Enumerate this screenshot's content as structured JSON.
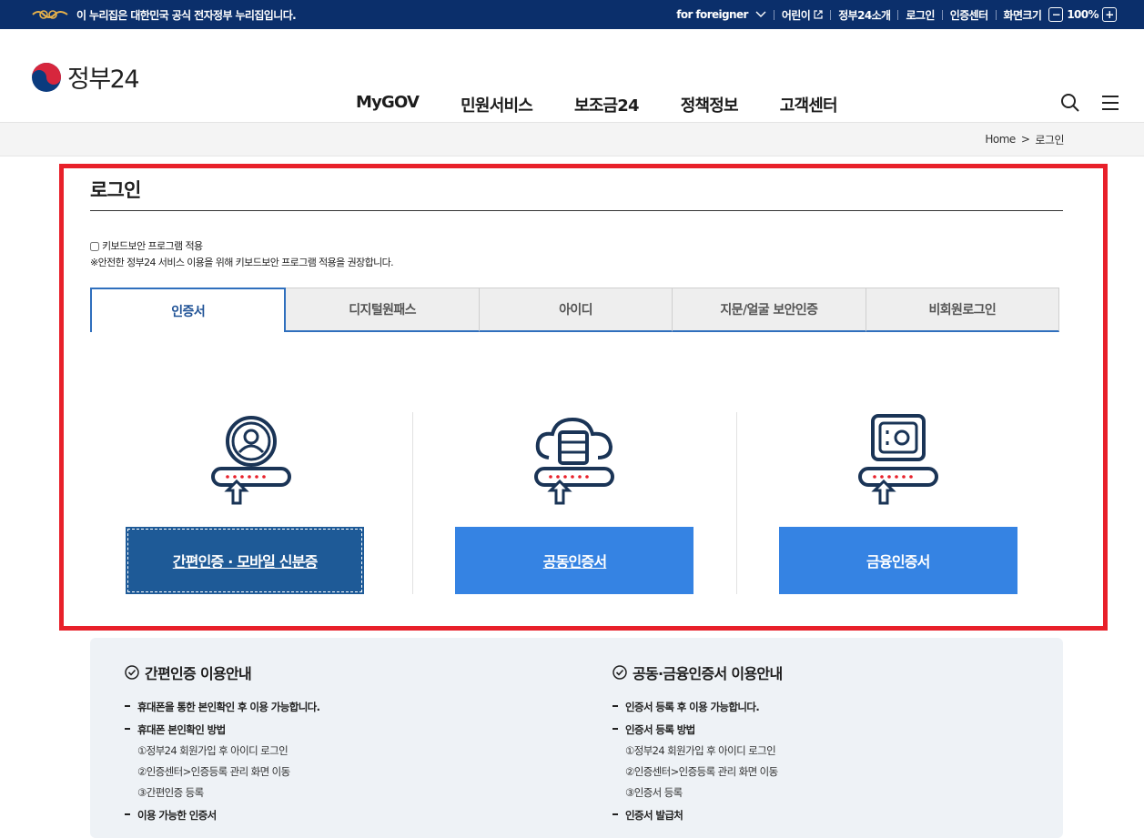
{
  "gov_banner": {
    "notice": "이 누리집은 대한민국 공식 전자정부 누리집입니다.",
    "links": [
      "for foreigner",
      "어린이",
      "정부24소개",
      "로그인",
      "인증센터"
    ],
    "screen_size_label": "화면크기",
    "zoom_level": "100%",
    "zoom_out": "−",
    "zoom_in": "+"
  },
  "header": {
    "logo_text": "정부24",
    "nav": [
      "MyGOV",
      "민원서비스",
      "보조금24",
      "정책정보",
      "고객센터"
    ]
  },
  "breadcrumb": {
    "home": "Home",
    "separator": ">",
    "current": "로그인"
  },
  "login": {
    "title": "로그인",
    "keyboard_label": "키보드보안 프로그램 적용",
    "keyboard_note": "※안전한 정부24 서비스 이용을 위해 키보드보안 프로그램 적용을 권장합니다.",
    "tabs": [
      "인증서",
      "디지털원패스",
      "아이디",
      "지문/얼굴 보안인증",
      "비회원로그인"
    ],
    "active_tab": "인증서",
    "cards": [
      {
        "icon": "user-icon",
        "button": "간편인증 · 모바일 신분증"
      },
      {
        "icon": "cloud-server-icon",
        "button": "공동인증서"
      },
      {
        "icon": "safe-icon",
        "button": "금융인증서"
      }
    ]
  },
  "info": {
    "left": {
      "title": "간편인증 이용안내",
      "items": [
        {
          "text": "휴대폰을 통한 본인확인 후 이용 가능합니다."
        },
        {
          "text": "휴대폰 본인확인 방법"
        }
      ],
      "steps": [
        "①정부24 회원가입 후 아이디 로그인",
        "②인증센터>인증등록 관리 화면 이동",
        "③간편인증 등록"
      ],
      "last": "이용 가능한 인증서"
    },
    "right": {
      "title": "공동·금융인증서 이용안내",
      "items": [
        {
          "text": "인증서 등록 후 이용 가능합니다."
        },
        {
          "text": "인증서 등록 방법"
        }
      ],
      "steps": [
        "①정부24 회원가입 후 아이디 로그인",
        "②인증센터>인증등록 관리 화면 이동",
        "③인증서 등록"
      ],
      "last": "인증서 발급처"
    }
  },
  "colors": {
    "gov_bar": "#0b2f6b",
    "highlight": "#e8202a",
    "button_blue": "#3583e3",
    "button_selected": "#1e5a97"
  }
}
